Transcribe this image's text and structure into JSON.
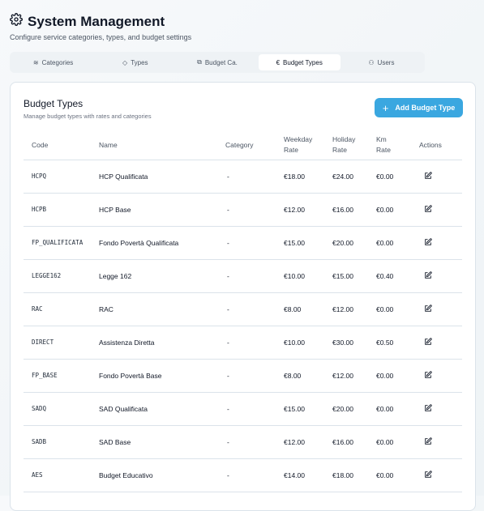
{
  "header": {
    "title": "System Management",
    "subtitle": "Configure service categories, types, and budget settings"
  },
  "tabs": [
    {
      "label": "Categories",
      "icon": "layers-icon"
    },
    {
      "label": "Types",
      "icon": "tag-icon"
    },
    {
      "label": "Budget Ca.",
      "icon": "category-icon"
    },
    {
      "label": "Budget Types",
      "icon": "euro-icon",
      "active": true
    },
    {
      "label": "Users",
      "icon": "users-icon"
    }
  ],
  "card": {
    "title": "Budget Types",
    "subtitle": "Manage budget types with rates and categories",
    "add_label": "Add Budget Type"
  },
  "table": {
    "headers": {
      "code": "Code",
      "name": "Name",
      "category": "Category",
      "weekday1": "Weekday",
      "weekday2": "Rate",
      "holiday1": "Holiday",
      "holiday2": "Rate",
      "km1": "Km",
      "km2": "Rate",
      "actions": "Actions"
    },
    "rows": [
      [
        "HCPQ",
        "HCP Qualificata",
        "-",
        "€18.00",
        "€24.00",
        "€0.00"
      ],
      [
        "HCPB",
        "HCP Base",
        "-",
        "€12.00",
        "€16.00",
        "€0.00"
      ],
      [
        "FP_QUALIFICATA",
        "Fondo Povertà Qualificata",
        "-",
        "€15.00",
        "€20.00",
        "€0.00"
      ],
      [
        "LEGGE162",
        "Legge 162",
        "-",
        "€10.00",
        "€15.00",
        "€0.40"
      ],
      [
        "RAC",
        "RAC",
        "-",
        "€8.00",
        "€12.00",
        "€0.00"
      ],
      [
        "DIRECT",
        "Assistenza Diretta",
        "-",
        "€10.00",
        "€30.00",
        "€0.50"
      ],
      [
        "FP_BASE",
        "Fondo Povertà Base",
        "-",
        "€8.00",
        "€12.00",
        "€0.00"
      ],
      [
        "SADQ",
        "SAD Qualificata",
        "-",
        "€15.00",
        "€20.00",
        "€0.00"
      ],
      [
        "SADB",
        "SAD Base",
        "-",
        "€12.00",
        "€16.00",
        "€0.00"
      ],
      [
        "AES",
        "Budget Educativo",
        "-",
        "€14.00",
        "€18.00",
        "€0.00"
      ]
    ]
  }
}
